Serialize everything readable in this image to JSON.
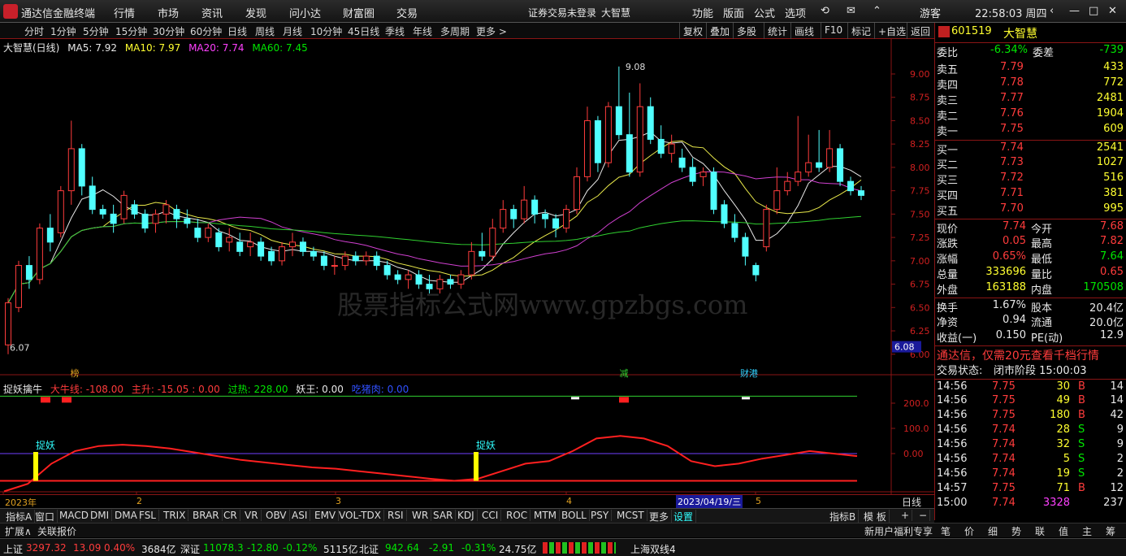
{
  "app": {
    "title": "通达信金融终端",
    "menus": [
      "行情",
      "市场",
      "资讯",
      "发现",
      "问小达",
      "财富圈",
      "交易"
    ],
    "notice": "证券交易未登录",
    "stock_name": "大智慧",
    "right_menus": [
      "功能",
      "版面",
      "公式",
      "选项"
    ],
    "user": "游客",
    "clock": "22:58:03 周四"
  },
  "toolbar": {
    "periods": [
      "分时",
      "1分钟",
      "5分钟",
      "15分钟",
      "30分钟",
      "60分钟",
      "日线",
      "周线",
      "月线",
      "10分钟",
      "45日线",
      "季线",
      "年线",
      "多周期",
      "更多 >"
    ],
    "active": "日线",
    "right_buttons": [
      "复权",
      "叠加",
      "多股",
      "统计",
      "画线",
      "F10",
      "标记",
      "+自选",
      "返回"
    ]
  },
  "main_legend": {
    "title": "大智慧(日线)",
    "ma5": "MA5: 7.92",
    "ma10": "MA10: 7.97",
    "ma20": "MA20: 7.74",
    "ma60": "MA60: 7.45"
  },
  "chart_data": {
    "type": "candlestick",
    "price_ticks": [
      "9.00",
      "8.75",
      "8.50",
      "8.25",
      "8.00",
      "7.75",
      "7.50",
      "7.25",
      "7.00",
      "6.75",
      "6.50",
      "6.25",
      "6.00"
    ],
    "ylim": [
      5.85,
      9.2
    ],
    "high_label": "9.08",
    "low_label": "6.07",
    "current_price_tag": "6.08",
    "x_labels": [
      "2023年",
      "2",
      "3",
      "4",
      "5"
    ],
    "cursor_date": "2023/04/19/三",
    "period_label": "日线",
    "event_tags": [
      "榜",
      "减",
      "财港"
    ],
    "candles": [
      [
        6.1,
        6.55,
        6.0,
        6.6
      ],
      [
        6.5,
        6.95,
        6.45,
        7.0
      ],
      [
        6.95,
        6.8,
        6.7,
        7.05
      ],
      [
        6.8,
        7.35,
        6.75,
        7.4
      ],
      [
        7.35,
        7.2,
        7.1,
        7.5
      ],
      [
        7.3,
        7.75,
        7.25,
        7.8
      ],
      [
        7.75,
        8.2,
        7.6,
        8.5
      ],
      [
        8.2,
        7.8,
        7.7,
        8.25
      ],
      [
        7.8,
        7.55,
        7.5,
        7.9
      ],
      [
        7.55,
        7.5,
        7.45,
        7.6
      ],
      [
        7.5,
        7.4,
        7.3,
        7.6
      ],
      [
        7.45,
        7.7,
        7.4,
        7.75
      ],
      [
        7.6,
        7.5,
        7.45,
        7.65
      ],
      [
        7.5,
        7.35,
        7.3,
        7.55
      ],
      [
        7.4,
        7.5,
        7.3,
        7.55
      ],
      [
        7.5,
        7.6,
        7.4,
        7.65
      ],
      [
        7.55,
        7.45,
        7.35,
        7.6
      ],
      [
        7.45,
        7.4,
        7.35,
        7.55
      ],
      [
        7.35,
        7.25,
        7.2,
        7.45
      ],
      [
        7.25,
        7.35,
        7.2,
        7.4
      ],
      [
        7.3,
        7.15,
        7.1,
        7.35
      ],
      [
        7.2,
        7.25,
        7.1,
        7.35
      ],
      [
        7.2,
        7.1,
        7.05,
        7.3
      ],
      [
        7.15,
        7.2,
        7.05,
        7.3
      ],
      [
        7.2,
        7.05,
        7.0,
        7.25
      ],
      [
        7.1,
        7.0,
        6.95,
        7.15
      ],
      [
        7.0,
        7.15,
        6.95,
        7.2
      ],
      [
        7.15,
        7.2,
        7.05,
        7.3
      ],
      [
        7.2,
        7.1,
        7.05,
        7.25
      ],
      [
        7.1,
        7.05,
        7.0,
        7.15
      ],
      [
        7.05,
        6.95,
        6.9,
        7.1
      ],
      [
        6.95,
        6.95,
        6.85,
        7.05
      ],
      [
        6.95,
        7.05,
        6.9,
        7.1
      ],
      [
        7.05,
        7.0,
        6.95,
        7.1
      ],
      [
        7.0,
        7.05,
        6.95,
        7.1
      ],
      [
        7.05,
        6.95,
        6.9,
        7.1
      ],
      [
        6.95,
        6.85,
        6.8,
        7.0
      ],
      [
        6.85,
        6.8,
        6.75,
        6.9
      ],
      [
        6.8,
        6.85,
        6.7,
        6.9
      ],
      [
        6.85,
        6.75,
        6.7,
        6.9
      ],
      [
        6.75,
        6.7,
        6.65,
        6.85
      ],
      [
        6.7,
        6.8,
        6.65,
        6.85
      ],
      [
        6.8,
        6.75,
        6.7,
        6.85
      ],
      [
        6.75,
        6.85,
        6.7,
        6.9
      ],
      [
        6.85,
        7.1,
        6.8,
        7.2
      ],
      [
        7.1,
        7.05,
        7.0,
        7.3
      ],
      [
        7.05,
        7.35,
        7.0,
        7.45
      ],
      [
        7.35,
        7.55,
        7.3,
        7.65
      ],
      [
        7.55,
        7.45,
        7.35,
        7.6
      ],
      [
        7.45,
        7.65,
        7.4,
        7.8
      ],
      [
        7.65,
        7.5,
        7.4,
        7.7
      ],
      [
        7.5,
        7.45,
        7.35,
        7.55
      ],
      [
        7.45,
        7.35,
        7.25,
        7.5
      ],
      [
        7.35,
        7.55,
        7.3,
        7.6
      ],
      [
        7.55,
        7.9,
        7.5,
        8.0
      ],
      [
        7.9,
        8.5,
        7.85,
        8.65
      ],
      [
        8.5,
        8.05,
        7.95,
        8.55
      ],
      [
        8.05,
        8.65,
        8.0,
        8.7
      ],
      [
        8.65,
        8.35,
        8.3,
        9.08
      ],
      [
        8.35,
        7.95,
        7.9,
        8.8
      ],
      [
        7.95,
        8.65,
        7.9,
        8.9
      ],
      [
        8.65,
        8.3,
        8.25,
        8.75
      ],
      [
        8.3,
        8.15,
        8.1,
        8.45
      ],
      [
        8.15,
        8.25,
        8.05,
        8.35
      ],
      [
        8.1,
        8.0,
        7.95,
        8.2
      ],
      [
        8.0,
        7.85,
        7.8,
        8.1
      ],
      [
        7.9,
        7.95,
        7.8,
        8.0
      ],
      [
        7.95,
        7.55,
        7.5,
        8.0
      ],
      [
        7.6,
        7.4,
        7.35,
        7.65
      ],
      [
        7.4,
        7.25,
        7.2,
        7.5
      ],
      [
        7.25,
        7.05,
        6.95,
        7.3
      ],
      [
        6.95,
        6.85,
        6.78,
        6.98
      ],
      [
        7.15,
        7.55,
        7.1,
        7.6
      ],
      [
        7.55,
        7.75,
        7.5,
        8.0
      ],
      [
        7.75,
        7.85,
        7.7,
        7.95
      ],
      [
        7.85,
        7.95,
        7.8,
        8.55
      ],
      [
        7.95,
        8.05,
        7.9,
        8.35
      ],
      [
        8.05,
        8.0,
        7.95,
        8.4
      ],
      [
        8.0,
        8.2,
        7.95,
        8.4
      ],
      [
        8.2,
        7.85,
        7.8,
        8.25
      ],
      [
        7.85,
        7.75,
        7.7,
        7.9
      ],
      [
        7.75,
        7.7,
        7.65,
        7.8
      ]
    ]
  },
  "ind_legend": {
    "name": "捉妖擒牛",
    "v1": "大牛线: -108.00",
    "v2": "主升: -15.05 : 0.00",
    "v3": "过热: 228.00",
    "v4": "妖王: 0.00",
    "v5": "吃猪肉: 0.00"
  },
  "ind_ticks": [
    "200.0",
    "100.0",
    "0.00"
  ],
  "ind_signals": [
    "捉妖",
    "捉妖"
  ],
  "watermark": "股票指标公式网www.gpzbgs.com",
  "bottom_tabs": [
    "指标A",
    "窗口",
    "MACD",
    "DMI",
    "DMA",
    "FSL",
    "TRIX",
    "BRAR",
    "CR",
    "VR",
    "OBV",
    "ASI",
    "EMV",
    "VOL-TDX",
    "RSI",
    "WR",
    "SAR",
    "KDJ",
    "CCI",
    "ROC",
    "MTM",
    "BOLL",
    "PSY",
    "MCST",
    "更多",
    "设置"
  ],
  "bottom_right": [
    "指标B",
    "模 板",
    "+",
    "−"
  ],
  "expand_bar": {
    "left": "扩展∧",
    "related": "关联报价",
    "center": "新用户福利专享",
    "tabs": [
      "笔",
      "价",
      "细",
      "势",
      "联",
      "值",
      "主",
      "筹"
    ]
  },
  "quote": {
    "code": "601519",
    "name": "大智慧",
    "ratio_label": "委比",
    "ratio": "-6.34%",
    "diff_label": "委差",
    "diff": "-739",
    "asks": [
      {
        "label": "卖五",
        "price": "7.79",
        "vol": "433"
      },
      {
        "label": "卖四",
        "price": "7.78",
        "vol": "772"
      },
      {
        "label": "卖三",
        "price": "7.77",
        "vol": "2481"
      },
      {
        "label": "卖二",
        "price": "7.76",
        "vol": "1904"
      },
      {
        "label": "卖一",
        "price": "7.75",
        "vol": "609"
      }
    ],
    "bids": [
      {
        "label": "买一",
        "price": "7.74",
        "vol": "2541"
      },
      {
        "label": "买二",
        "price": "7.73",
        "vol": "1027"
      },
      {
        "label": "买三",
        "price": "7.72",
        "vol": "516"
      },
      {
        "label": "买四",
        "price": "7.71",
        "vol": "381"
      },
      {
        "label": "买五",
        "price": "7.70",
        "vol": "995"
      }
    ],
    "stats": [
      [
        "现价",
        "7.74",
        "今开",
        "7.68"
      ],
      [
        "涨跌",
        "0.05",
        "最高",
        "7.82"
      ],
      [
        "涨幅",
        "0.65%",
        "最低",
        "7.64"
      ],
      [
        "总量",
        "333696",
        "量比",
        "0.65"
      ],
      [
        "外盘",
        "163188",
        "内盘",
        "170508"
      ]
    ],
    "stats2": [
      [
        "换手",
        "1.67%",
        "股本",
        "20.4亿"
      ],
      [
        "净资",
        "0.94",
        "流通",
        "20.0亿"
      ],
      [
        "收益(一)",
        "0.150",
        "PE(动)",
        "12.9"
      ]
    ],
    "promo": "通达信，仅需20元查看千档行情",
    "state_label": "交易状态:",
    "state": "闭市阶段 15:00:03",
    "ticks": [
      [
        "14:56",
        "7.75",
        "30",
        "B",
        "14"
      ],
      [
        "14:56",
        "7.75",
        "49",
        "B",
        "14"
      ],
      [
        "14:56",
        "7.75",
        "180",
        "B",
        "42"
      ],
      [
        "14:56",
        "7.74",
        "28",
        "S",
        "9"
      ],
      [
        "14:56",
        "7.74",
        "32",
        "S",
        "9"
      ],
      [
        "14:56",
        "7.74",
        "5",
        "S",
        "2"
      ],
      [
        "14:56",
        "7.74",
        "19",
        "S",
        "2"
      ],
      [
        "14:57",
        "7.75",
        "71",
        "B",
        "12"
      ],
      [
        "15:00",
        "7.74",
        "3328",
        "",
        "237"
      ]
    ]
  },
  "status": {
    "sh": "上证",
    "sh_v": "3297.32",
    "sh_c": "13.09",
    "sh_p": "0.40%",
    "sh_amt": "3684亿",
    "sz": "深证",
    "sz_v": "11078.3",
    "sz_c": "-12.80",
    "sz_p": "-0.12%",
    "sz_amt": "5115亿",
    "bz": "北证",
    "bz_v": "942.64",
    "bz_c": "-2.91",
    "bz_p": "-0.31%",
    "bz_amt": "24.75亿",
    "right": "上海双线4"
  }
}
